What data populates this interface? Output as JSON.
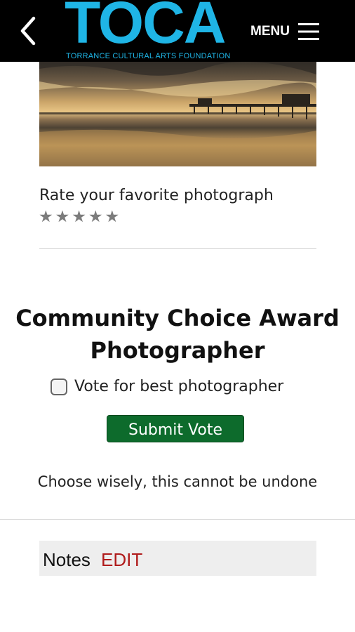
{
  "header": {
    "logo_text": "TOCA",
    "logo_subtitle": "TORRANCE CULTURAL ARTS FOUNDATION",
    "menu_label": "MENU",
    "brand_color": "#1fb5e6"
  },
  "photo": {
    "description_icon": "pier-sunset-photo"
  },
  "rating": {
    "label": "Rate your favorite photograph",
    "stars": [
      "★",
      "★",
      "★",
      "★",
      "★"
    ],
    "star_color": "#7c7c7c"
  },
  "award": {
    "title_line1": "Community Choice Award",
    "title_line2": "Photographer",
    "vote_label": "Vote for best photographer",
    "vote_checked": false,
    "submit_label": "Submit Vote",
    "submit_color": "#0d6b2c",
    "warning": "Choose wisely, this cannot be undone"
  },
  "notes": {
    "label": "Notes",
    "edit_label": "EDIT",
    "edit_color": "#b01b1b"
  }
}
